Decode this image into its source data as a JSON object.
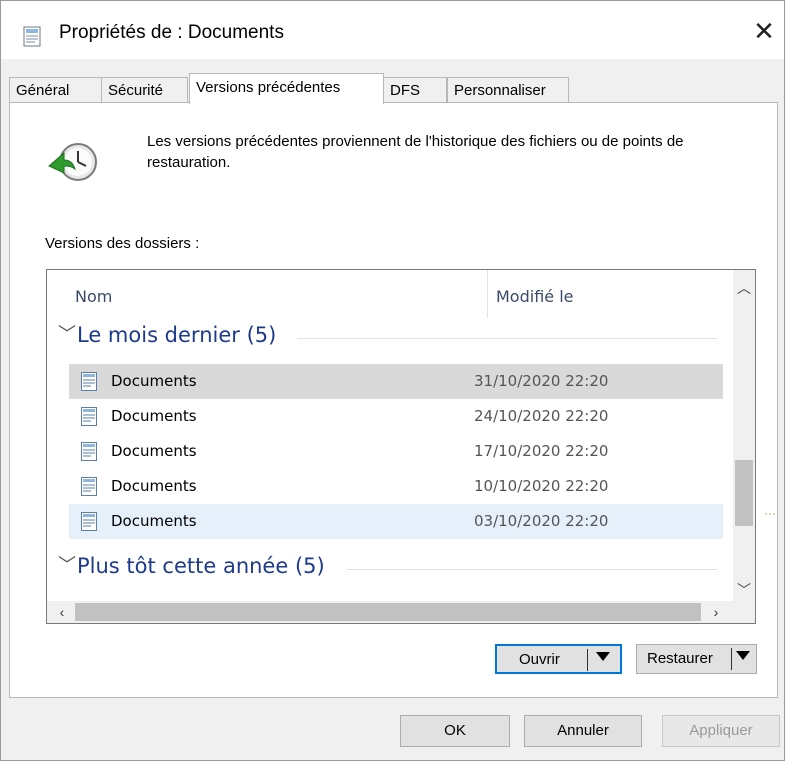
{
  "window": {
    "title": "Propriétés de : Documents",
    "close_glyph": "✕"
  },
  "tabs": [
    {
      "label": "Général"
    },
    {
      "label": "Sécurité"
    },
    {
      "label": "Versions précédentes",
      "active": true
    },
    {
      "label": "DFS"
    },
    {
      "label": "Personnaliser"
    }
  ],
  "panel": {
    "description": "Les versions précédentes proviennent de l'historique des fichiers ou de points de restauration.",
    "versions_label": "Versions des dossiers :"
  },
  "list": {
    "columns": {
      "name": "Nom",
      "modified": "Modifié le"
    },
    "groups": [
      {
        "label": "Le mois dernier (5)"
      },
      {
        "label": "Plus tôt cette année (5)"
      }
    ],
    "rows": [
      {
        "name": "Documents",
        "date": "31/10/2020 22:20",
        "state": "selected"
      },
      {
        "name": "Documents",
        "date": "24/10/2020 22:20",
        "state": ""
      },
      {
        "name": "Documents",
        "date": "17/10/2020 22:20",
        "state": ""
      },
      {
        "name": "Documents",
        "date": "10/10/2020 22:20",
        "state": ""
      },
      {
        "name": "Documents",
        "date": "03/10/2020 22:20",
        "state": "hover"
      }
    ]
  },
  "actions": {
    "open": "Ouvrir",
    "restore": "Restaurer"
  },
  "footer": {
    "ok": "OK",
    "cancel": "Annuler",
    "apply": "Appliquer"
  },
  "colors": {
    "accent": "#0078d7",
    "group_text": "#1e3a8a",
    "selected_row": "#d9d9d9",
    "hover_row": "#e5f0fa"
  },
  "icons": [
    "document-properties-icon",
    "close-icon",
    "history-clock-icon",
    "folder-document-icon",
    "chevron-down-icon",
    "chevron-up-icon",
    "chevron-left-icon",
    "chevron-right-icon",
    "dropdown-arrow-icon"
  ]
}
